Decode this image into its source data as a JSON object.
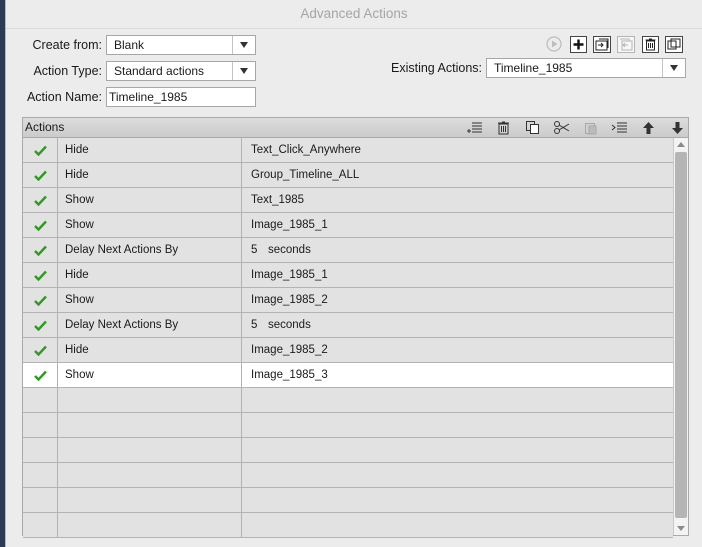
{
  "window": {
    "title": "Advanced Actions"
  },
  "form": {
    "create_from_label": "Create from:",
    "create_from_value": "Blank",
    "action_type_label": "Action Type:",
    "action_type_value": "Standard actions",
    "action_name_label": "Action Name:",
    "action_name_value": "Timeline_1985",
    "existing_actions_label": "Existing Actions:",
    "existing_actions_value": "Timeline_1985"
  },
  "top_icons": [
    "preview-play-icon",
    "add-new-action-icon",
    "save-as-template-icon",
    "duplicate-action-icon",
    "delete-action-icon",
    "usage-icon"
  ],
  "panel": {
    "title": "Actions",
    "toolbar_icons": [
      "add-row-icon",
      "delete-row-icon",
      "copy-icon",
      "cut-icon",
      "paste-icon",
      "insert-row-icon",
      "move-up-icon",
      "move-down-icon"
    ],
    "rows": [
      {
        "status": "check",
        "action": "Hide",
        "target": "Text_Click_Anywhere"
      },
      {
        "status": "check",
        "action": "Hide",
        "target": "Group_Timeline_ALL"
      },
      {
        "status": "check",
        "action": "Show",
        "target": "Text_1985"
      },
      {
        "status": "check",
        "action": "Show",
        "target": "Image_1985_1"
      },
      {
        "status": "check",
        "action": "Delay Next Actions By",
        "target": "seconds",
        "number": "5"
      },
      {
        "status": "check",
        "action": "Hide",
        "target": "Image_1985_1"
      },
      {
        "status": "check",
        "action": "Show",
        "target": "Image_1985_2"
      },
      {
        "status": "check",
        "action": "Delay Next Actions By",
        "target": "seconds",
        "number": "5"
      },
      {
        "status": "check",
        "action": "Hide",
        "target": "Image_1985_2"
      },
      {
        "status": "check",
        "action": "Show",
        "target": "Image_1985_3",
        "selected": true
      },
      {
        "status": "",
        "action": "",
        "target": ""
      },
      {
        "status": "",
        "action": "",
        "target": ""
      },
      {
        "status": "",
        "action": "",
        "target": ""
      },
      {
        "status": "",
        "action": "",
        "target": ""
      },
      {
        "status": "",
        "action": "",
        "target": ""
      },
      {
        "status": "",
        "action": "",
        "target": ""
      }
    ]
  },
  "colors": {
    "check": "#2e9a1f",
    "background": "#ececec"
  }
}
